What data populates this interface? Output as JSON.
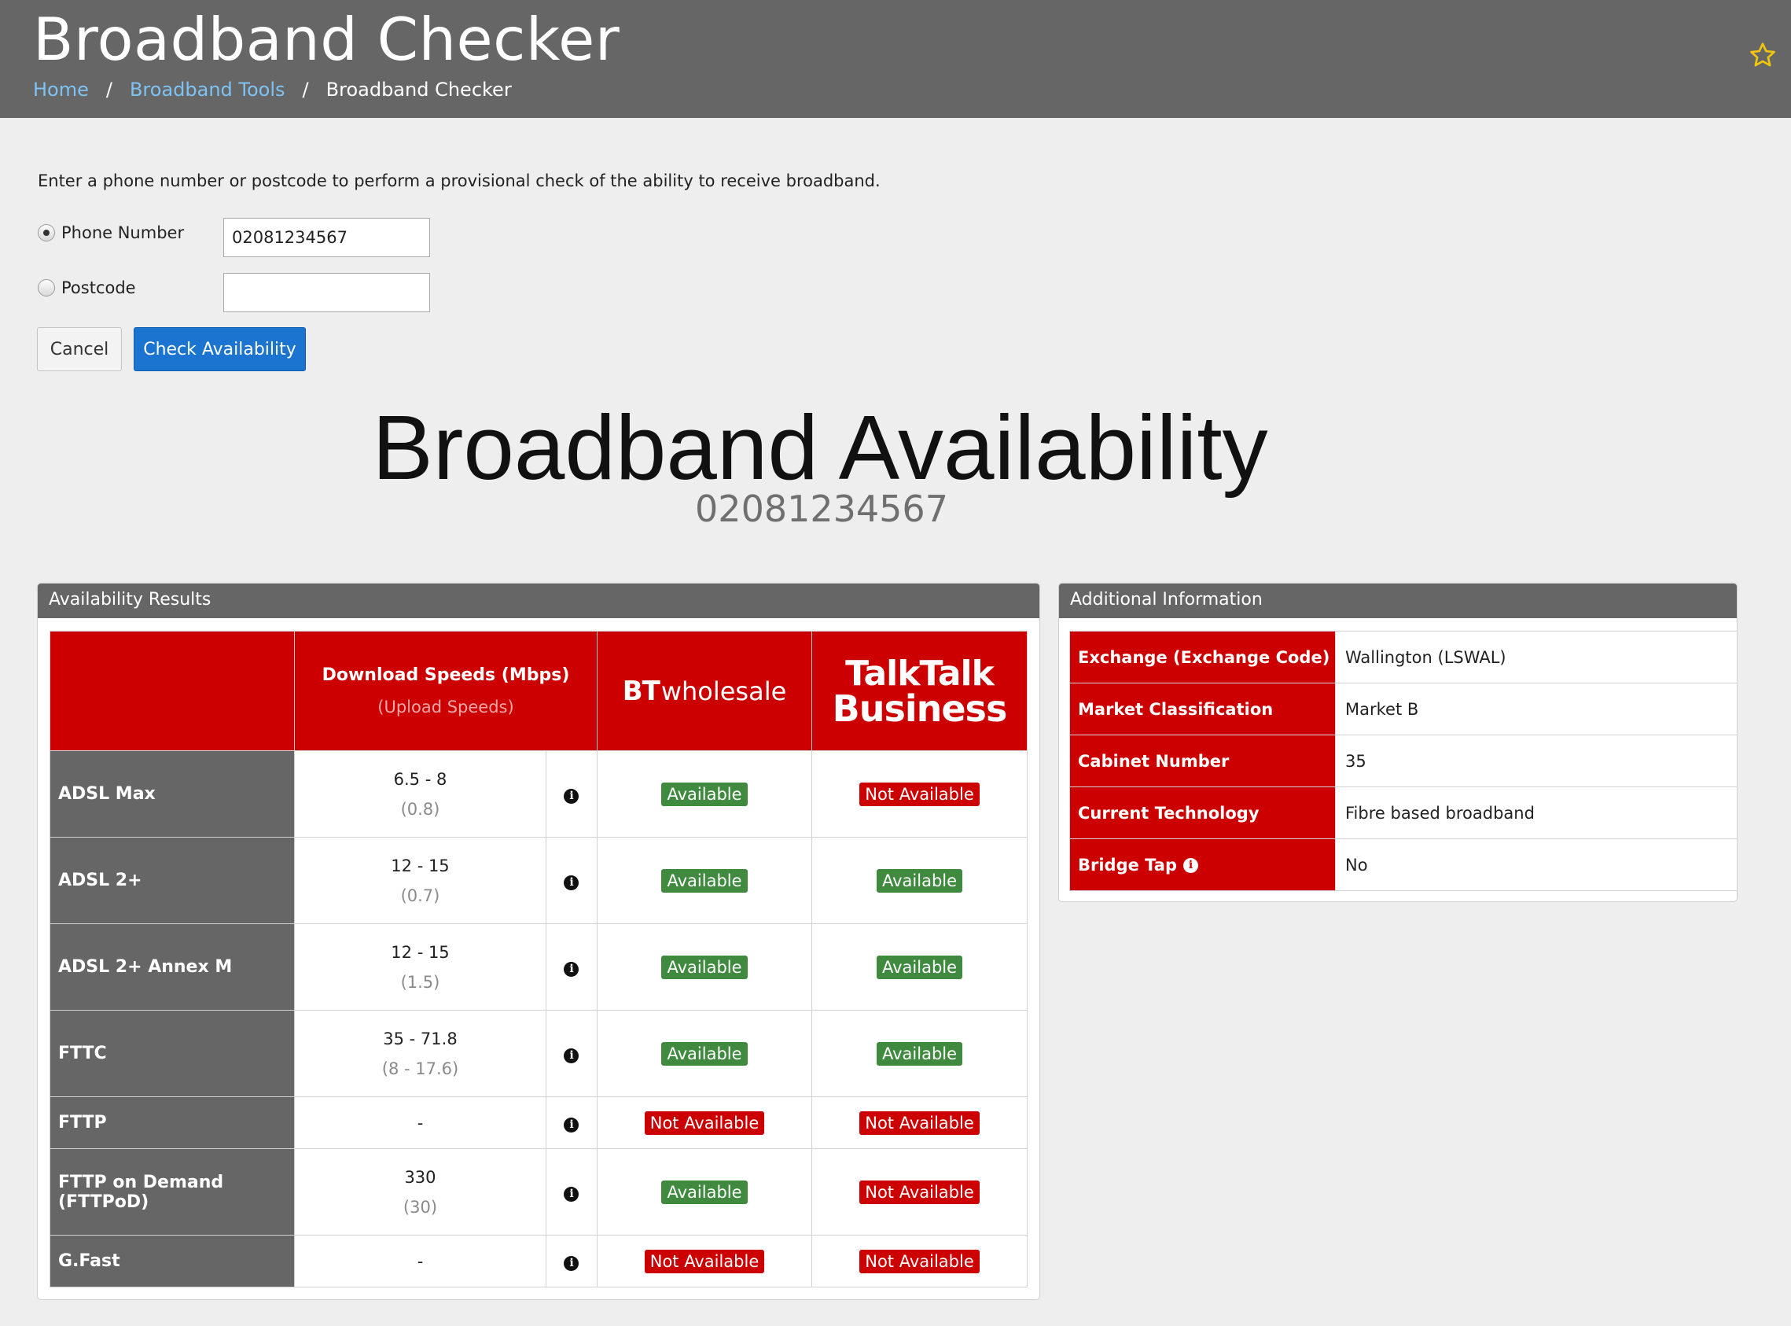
{
  "header": {
    "title": "Broadband Checker",
    "breadcrumb": [
      "Home",
      "Broadband Tools",
      "Broadband Checker"
    ],
    "separator": "/"
  },
  "form": {
    "intro": "Enter a phone number or postcode to perform a provisional check of the ability to receive broadband.",
    "phone_label": "Phone Number",
    "phone_value": "02081234567",
    "phone_selected": true,
    "postcode_label": "Postcode",
    "postcode_value": "",
    "cancel_label": "Cancel",
    "check_label": "Check Availability"
  },
  "availability": {
    "title": "Broadband Availability",
    "phone": "02081234567"
  },
  "results": {
    "panel_title": "Availability Results",
    "speed_header": "Download Speeds (Mbps)",
    "speed_subheader": "(Upload Speeds)",
    "bt_logo_bold": "BT",
    "bt_logo_text": "wholesale",
    "tt_logo_line1": "TalkTalk",
    "tt_logo_line2": "Business",
    "rows": [
      {
        "name": "ADSL Max",
        "download": "6.5 - 8",
        "upload": "(0.8)",
        "bt": "Available",
        "tt": "Not Available"
      },
      {
        "name": "ADSL 2+",
        "download": "12 - 15",
        "upload": "(0.7)",
        "bt": "Available",
        "tt": "Available"
      },
      {
        "name": "ADSL 2+ Annex M",
        "download": "12 - 15",
        "upload": "(1.5)",
        "bt": "Available",
        "tt": "Available"
      },
      {
        "name": "FTTC",
        "download": "35 - 71.8",
        "upload": "(8 - 17.6)",
        "bt": "Available",
        "tt": "Available"
      },
      {
        "name": "FTTP",
        "download": "-",
        "upload": "",
        "bt": "Not Available",
        "tt": "Not Available"
      },
      {
        "name": "FTTP on Demand (FTTPoD)",
        "download": "330",
        "upload": "(30)",
        "bt": "Available",
        "tt": "Not Available"
      },
      {
        "name": "G.Fast",
        "download": "-",
        "upload": "",
        "bt": "Not Available",
        "tt": "Not Available"
      }
    ]
  },
  "info": {
    "panel_title": "Additional Information",
    "rows": [
      {
        "label": "Exchange (Exchange Code)",
        "value": "Wallington (LSWAL)",
        "has_icon": false
      },
      {
        "label": "Market Classification",
        "value": "Market B",
        "has_icon": false
      },
      {
        "label": "Cabinet Number",
        "value": "35",
        "has_icon": false
      },
      {
        "label": "Current Technology",
        "value": "Fibre based broadband",
        "has_icon": false
      },
      {
        "label": "Bridge Tap",
        "value": "No",
        "has_icon": true
      }
    ]
  },
  "colors": {
    "header_bg": "#666666",
    "brand_red": "#cc0000",
    "available_green": "#3f8a3f",
    "link_blue": "#7ec3f4",
    "primary_button": "#1a74d0",
    "star": "#f1c40f"
  }
}
